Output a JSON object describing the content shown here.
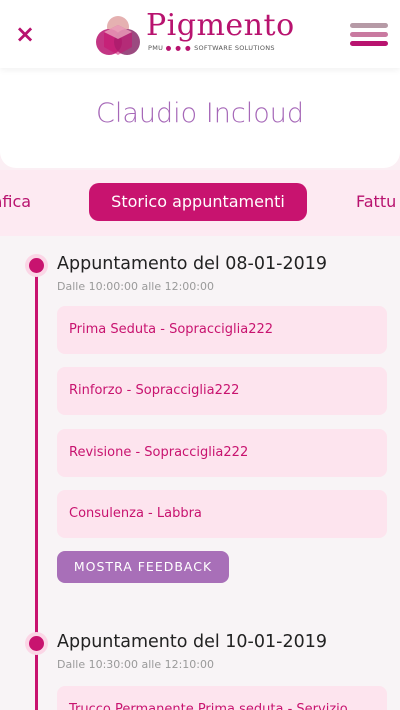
{
  "header": {
    "close_label": "×",
    "logo_name": "Pigmento",
    "logo_sub_left": "PMU",
    "logo_sub_dots": "● ● ●",
    "logo_sub_right": "SOFTWARE SOLUTIONS",
    "menu_icon": "hamburger-menu-icon"
  },
  "profile": {
    "name": "Claudio Incloud"
  },
  "tabs": {
    "left_label": "rafica",
    "active_label": "Storico appuntamenti",
    "right_label": "Fattu"
  },
  "appointments": [
    {
      "title": "Appuntamento del 08-01-2019",
      "time": "Dalle 10:00:00 alle 12:00:00",
      "services": [
        "Prima Seduta - Sopracciglia222",
        "Rinforzo - Sopracciglia222",
        "Revisione - Sopracciglia222",
        "Consulenza - Labbra"
      ],
      "feedback_label": "MOSTRA FEEDBACK"
    },
    {
      "title": "Appuntamento del 10-01-2019",
      "time": "Dalle 10:30:00 alle 12:10:00",
      "services": [
        "Trucco Permanente Prima seduta - Servizio"
      ]
    }
  ],
  "colors": {
    "brand": "#c8136f",
    "accent_purple": "#a86fb8",
    "service_bg": "#fde4ee"
  }
}
